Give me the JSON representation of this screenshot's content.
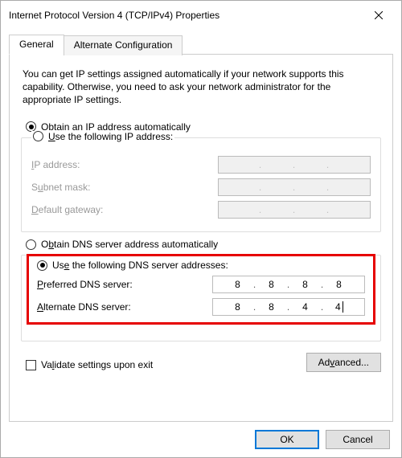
{
  "window": {
    "title": "Internet Protocol Version 4 (TCP/IPv4) Properties"
  },
  "tabs": {
    "general": "General",
    "alternate": "Alternate Configuration",
    "active": "general"
  },
  "intro": "You can get IP settings assigned automatically if your network supports this capability. Otherwise, you need to ask your network administrator for the appropriate IP settings.",
  "ip": {
    "auto_label": "Obtain an IP address automatically",
    "manual_label": "Use the following IP address:",
    "selected": "auto",
    "fields": {
      "ip_label": "IP address:",
      "subnet_label": "Subnet mask:",
      "gateway_label": "Default gateway:",
      "ip_value": [
        "",
        "",
        "",
        ""
      ],
      "subnet_value": [
        "",
        "",
        "",
        ""
      ],
      "gateway_value": [
        "",
        "",
        "",
        ""
      ]
    }
  },
  "dns": {
    "auto_label": "Obtain DNS server address automatically",
    "manual_label": "Use the following DNS server addresses:",
    "selected": "manual",
    "fields": {
      "pref_label": "Preferred DNS server:",
      "alt_label": "Alternate DNS server:",
      "pref_value": [
        "8",
        "8",
        "8",
        "8"
      ],
      "alt_value": [
        "8",
        "8",
        "4",
        "4"
      ]
    }
  },
  "validate": {
    "label": "Validate settings upon exit",
    "checked": false
  },
  "buttons": {
    "advanced": "Advanced...",
    "ok": "OK",
    "cancel": "Cancel"
  }
}
